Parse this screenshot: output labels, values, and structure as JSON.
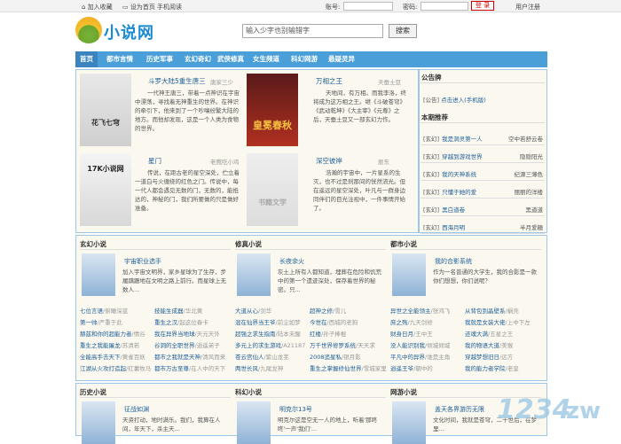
{
  "topbar": {
    "add_fav": "加入收藏",
    "set_home": "设为首页",
    "mobile": "手机阅读",
    "account_label": "账号:",
    "password_label": "密码:",
    "login_btn": "登 录",
    "register": "用户注册"
  },
  "logo": {
    "text": "小说网"
  },
  "search": {
    "placeholder": "输入少字也别输错字",
    "button": "搜索"
  },
  "nav": [
    "首页",
    "都市言情",
    "历史军事",
    "玄幻奇幻",
    "武侠修真",
    "女生频道",
    "科幻网游",
    "悬疑灵异"
  ],
  "featured": [
    {
      "title": "斗罗大陆5重生唐三",
      "author": "唐家三少",
      "desc": "一代神王唐三，带着一点神识在宇宙中漂荡，寻找着无神重生的世界。在神识的牵引下，他来到了一个吵嚷纷繁大陆的地方。而他却发现，这是一个人类为食物的世界。",
      "cover_text": "花飞七穹"
    },
    {
      "title": "万相之王",
      "author": "天蚕土豆",
      "desc": "天地间，有万相。而我李洛，终将成为这万相之王。继《斗破苍穹》《武动乾坤》《大主宰》《元尊》之后，天蚕土豆又一部玄幻力作。",
      "cover_text": "皇冕春秋"
    },
    {
      "title": "星门",
      "author": "老鹰吃小鸡",
      "desc": "传说，在距古老的星空深处，伫立着一道白与火缠绕的红色之门。传说中，每一代人都会遇见无数的门，无数的，能抵达的，神秘的门，我们所要做的只是做好准备。",
      "cover_text": "17K小说网"
    },
    {
      "title": "深空彼岸",
      "author": "辰东",
      "desc": "浩瀚的宇宙中，一片星系的生灭，也不过是刹那间的恍然流光。但在遥远的星空深处，叶凡与一群身边同伴们的目光注视中，一件事情开始了。",
      "cover_text": "书籍文学"
    }
  ],
  "side": {
    "notice_title": "公告牌",
    "notice": {
      "tag": "[公告]",
      "text": "点击进入(手机版)"
    },
    "rec_title": "本期推荐",
    "rec": [
      {
        "tag": "[玄幻]",
        "name": "我是洞灵第一人",
        "author": "空中若舒云卷"
      },
      {
        "tag": "[玄幻]",
        "name": "穿越到游戏世界",
        "author": "隐隐阳光"
      },
      {
        "tag": "[玄幻]",
        "name": "我的天神系统",
        "author": "纪源三薄色"
      },
      {
        "tag": "[玄幻]",
        "name": "只懂于她的爱",
        "author": "丽丽的洋楼"
      },
      {
        "tag": "[玄幻]",
        "name": "黑白道卷",
        "author": "黑道道"
      },
      {
        "tag": "[玄幻]",
        "name": "西海月明",
        "author": "半月爱糖"
      }
    ]
  },
  "sections": [
    {
      "name": "玄幻小说",
      "top_title": "宇宙职业选手",
      "top_desc": "加入宇宙文明界，家乡星球为了生存，步履蹒跚地在文明之路上前行。而星球上无数人...",
      "list": [
        [
          "七位言语",
          "俯瞰深蓝",
          "技能生成器",
          "华北黄"
        ],
        [
          "第一帅",
          "严重于此",
          "重生之汉",
          "起这位春卡"
        ],
        [
          "赫兹和你的超能力者",
          "情谷",
          "我在异界当地球",
          "天元天外"
        ],
        [
          "重生之我能屠龙",
          "苏清若",
          "谷洞的全职世界",
          "逍遥弟子"
        ],
        [
          "全能高手去天下",
          "黄雀百妖",
          "都市之我就是天神",
          "清风而来"
        ],
        [
          "江湖从火攻打造起",
          "红薯牧马",
          "都市万古至尊",
          "在人中的天下"
        ]
      ]
    },
    {
      "name": "修真小说",
      "top_title": "长夜余火",
      "top_desc": "灰土上所有人都知道，埋葬在危险和饥荒中的第一个遗迹深处，保存着世界的秘密。只...",
      "list": [
        [
          "大道从心",
          "剑华",
          "超神之修",
          "雪儿"
        ],
        [
          "混在仙界当王爷",
          "前尘如梦",
          "今世在",
          "西城的老狗"
        ],
        [
          "超强之求生指南",
          "陆本未醒",
          "红楼",
          "孙子棒棍"
        ],
        [
          "多元上的求生游戏",
          "A21187",
          "万千世界修罗系统",
          "天天求"
        ],
        [
          "苍云宫仙人",
          "紫山龙芜",
          "2008追星私",
          "银月影"
        ],
        [
          "两世长风",
          "九尾龙神",
          "重生之掌握修仙世界",
          "雪城家里"
        ]
      ]
    },
    {
      "name": "都市小说",
      "top_title": "我的合影系统",
      "top_desc": "作为一名普通的大学生，我的合影是一款你们想想，你们说呢？",
      "list": [
        [
          "异世之全能领主",
          "张鸿飞",
          "从背包到晶壁系",
          "蜗壳"
        ],
        [
          "庶之殇",
          "九天剑修",
          "我就是女装大佬",
          "上中下左"
        ],
        [
          "财身日月",
          "王中王",
          "还魂大满",
          "五星之王"
        ],
        [
          "没人能识别我",
          "倾城倾城",
          "我的物语大道",
          "美猴"
        ],
        [
          "平凡中的异界",
          "谁是主角",
          "穿越梦想旧日",
          "远方"
        ],
        [
          "逍遥王爷",
          "朝中的",
          "我的能力者学院",
          "老皇"
        ]
      ]
    },
    {
      "name": "历史小说",
      "top_title": "征战如渊",
      "top_desc": "天资打动，地时满乐。我们，我算在人间，年天下，杀主天..."
    },
    {
      "name": "科幻小说",
      "top_title": "明克尔13号",
      "top_desc": "明克尔这是空无一人的地上，听着'那咚咚'一声'我们'..."
    },
    {
      "name": "网游小说",
      "top_title": "盖天各界游历无限",
      "top_desc": "文化时间，我就是苍穹，二十世后，在梦里..."
    }
  ]
}
